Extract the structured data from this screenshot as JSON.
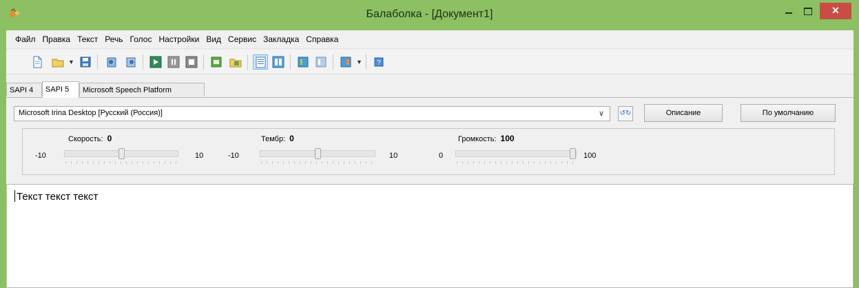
{
  "window": {
    "title": "Балаболка - [Документ1]",
    "accent": "#8cc063",
    "close_color": "#c94d44"
  },
  "menu": {
    "items": [
      "Файл",
      "Правка",
      "Текст",
      "Речь",
      "Голос",
      "Настройки",
      "Вид",
      "Сервис",
      "Закладка",
      "Справка"
    ]
  },
  "toolbar": {
    "buttons": [
      "new-document-icon",
      "open-folder-icon",
      "save-icon",
      "read-clipboard-icon",
      "read-file-icon",
      "play-icon",
      "pause-icon",
      "stop-icon",
      "convert-icon",
      "convert-folder-icon",
      "text-view-icon",
      "split-view-icon",
      "book-icon",
      "book2-icon",
      "export-icon",
      "help-icon"
    ]
  },
  "tabs": {
    "items": [
      "SAPI 4",
      "SAPI 5",
      "Microsoft Speech Platform"
    ],
    "active": "SAPI 5"
  },
  "voice": {
    "selected": "Microsoft Irina Desktop [Русский (Россия)]",
    "description_label": "Описание",
    "default_label": "По умолчанию"
  },
  "sliders": {
    "speed": {
      "label": "Скорость:",
      "value": "0",
      "min": "-10",
      "max": "10",
      "level": 0.5
    },
    "pitch": {
      "label": "Тембр:",
      "value": "0",
      "min": "-10",
      "max": "10",
      "level": 0.5
    },
    "volume": {
      "label": "Громкость:",
      "value": "100",
      "min": "0",
      "max": "100",
      "level": 1.0
    }
  },
  "editor": {
    "text": "Текст текст текст"
  }
}
